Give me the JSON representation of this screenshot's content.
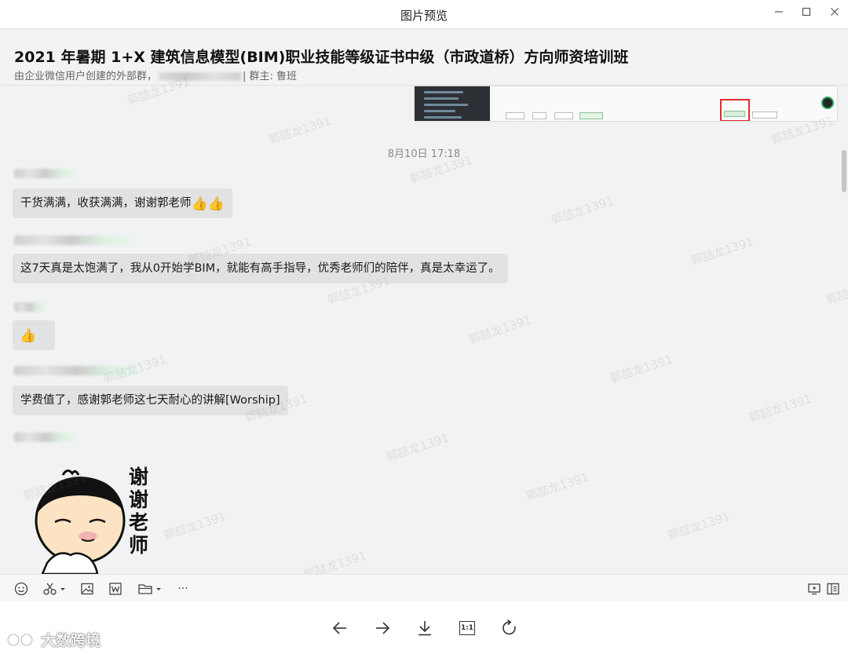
{
  "window": {
    "title": "图片预览"
  },
  "chat": {
    "group_title": "2021 年暑期 1+X 建筑信息模型(BIM)职业技能等级证书中级（市政道桥）方向师资培训班",
    "subtitle_prefix": "由企业微信用户创建的外部群，",
    "subtitle_owner": "| 群主: 鲁班",
    "timestamp": "8月10日 17:18",
    "messages": [
      {
        "text": "干货满满，收获满满，谢谢郭老师",
        "emoji": "👍👍"
      },
      {
        "text": "这7天真是太饱满了，我从0开始学BIM，就能有高手指导，优秀老师们的陪伴，真是太幸运了。",
        "emoji": ""
      },
      {
        "text": "",
        "emoji": "👍"
      },
      {
        "text": "学费值了，感谢郭老师这七天耐心的讲解[Worship]",
        "emoji": ""
      }
    ],
    "sticker_text": "谢谢老师",
    "watermark": "郭喆龙1391"
  },
  "toolbar": {
    "icons": [
      "emoji-icon",
      "scissors-icon",
      "image-icon",
      "word-icon",
      "folder-icon",
      "more-icon",
      "screen-icon",
      "sidebar-icon"
    ],
    "more_label": "···"
  },
  "controls": {
    "zoom_label": "1:1",
    "brand": "大数跨境"
  },
  "colors": {
    "accent_red": "#e12b2b",
    "bubble": "#e1e2e4",
    "chat_bg": "#f1f2f4"
  }
}
